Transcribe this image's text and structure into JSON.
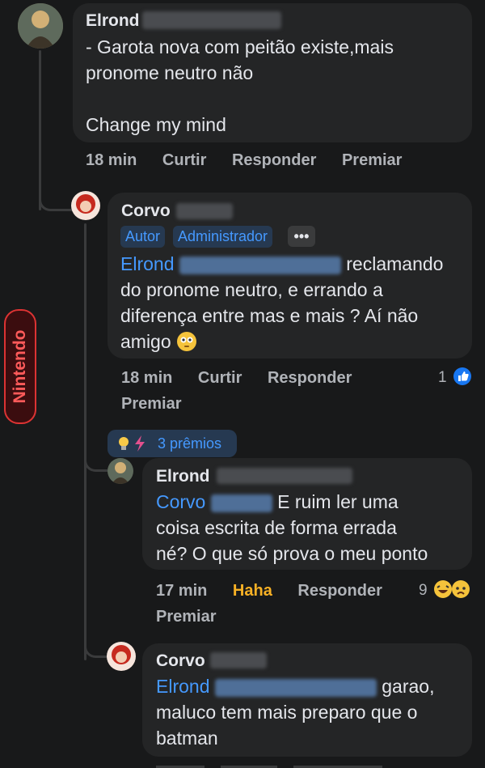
{
  "comments": [
    {
      "author": "Elrond",
      "lines": [
        "- Garota nova com peitão existe,mais",
        "pronome neutro não",
        "",
        "Change my mind"
      ],
      "time": "18 min",
      "like": "Curtir",
      "reply": "Responder",
      "award": "Premiar"
    },
    {
      "author": "Corvo",
      "badges": [
        "Autor",
        "Administrador"
      ],
      "more": "•••",
      "mention": "Elrond",
      "first_line_rest": "reclamando",
      "lines": [
        "do pronome neutro, e errando a",
        "diferença entre mas e mais ? Aí não",
        "amigo"
      ],
      "time": "18 min",
      "like": "Curtir",
      "reply": "Responder",
      "award": "Premiar",
      "reaction_count": "1"
    },
    {
      "awards": "3 prêmios",
      "author": "Elrond",
      "mention": "Corvo",
      "first_line_rest": "E ruim ler uma",
      "lines": [
        "coisa escrita de forma errada",
        "né? O que só prova o meu ponto"
      ],
      "time": "17 min",
      "like": "Haha",
      "reply": "Responder",
      "award": "Premiar",
      "reaction_count": "9"
    },
    {
      "author": "Corvo",
      "mention": "Elrond",
      "first_line_rest": "garao,",
      "lines": [
        "maluco tem mais preparo que o",
        "batman"
      ]
    }
  ],
  "watermark": "Nintendo",
  "colors": {
    "background": "#18191a",
    "bubble": "#242526",
    "link": "#4599ff",
    "haha": "#f7b125"
  }
}
